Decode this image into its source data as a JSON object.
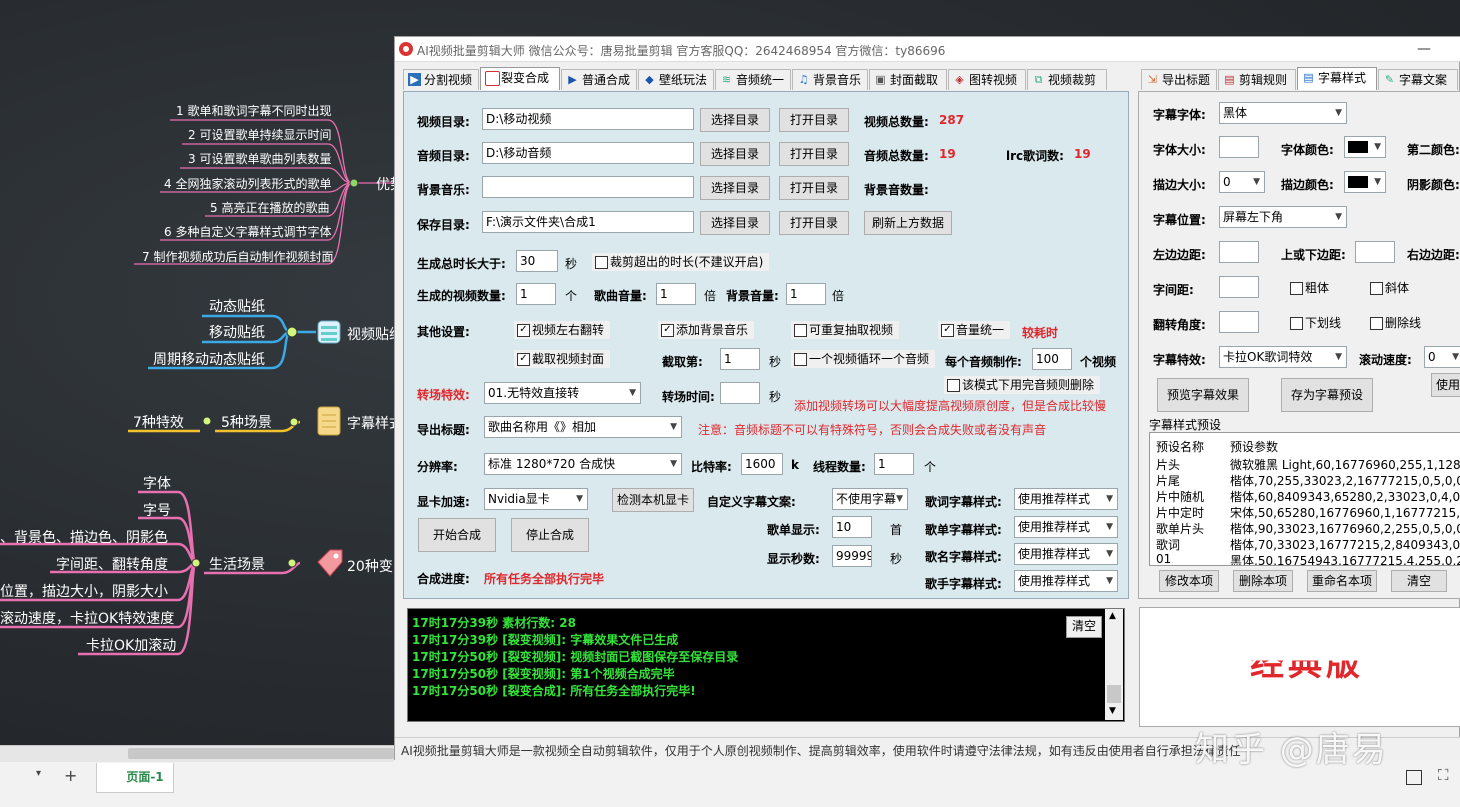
{
  "mindmap": {
    "branch1_items": [
      "1  歌单和歌词字幕不同时出现",
      "2  可设置歌单持续显示时间",
      "3  可设置歌单歌曲列表数量",
      "4  全网独家滚动列表形式的歌单",
      "5  高亮正在播放的歌曲",
      "6  多种自定义字幕样式调节字体",
      "7  制作视频成功后自动制作视频封面"
    ],
    "branch1_node": "优势",
    "branch2_items": [
      "动态贴纸",
      "移动贴纸",
      "周期移动动态贴纸"
    ],
    "branch2_node": "视频贴纸",
    "branch3_left": "7种特效",
    "branch3_mid": "5种场景",
    "branch3_node": "字幕样式",
    "branch4_items": [
      "字体",
      "字号",
      "、背景色、描边色、阴影色",
      "字间距、翻转角度",
      "位置，描边大小，阴影大小",
      "滚动速度，卡拉OK特效速度",
      "卡拉OK加滚动"
    ],
    "branch4_mid": "生活场景",
    "branch4_node": "20种变"
  },
  "sheetbar": {
    "tab": "页面-1",
    "add": "+"
  },
  "window": {
    "title": "AI视频批量剪辑大师  微信公众号：唐易批量剪辑  官方客服QQ：2642468954  官方微信：ty86696",
    "minimize": "—",
    "tabs": [
      "分割视频",
      "裂变合成",
      "普通合成",
      "壁纸玩法",
      "音频统一",
      "背景音乐",
      "封面截取",
      "图转视频",
      "视频裁剪"
    ],
    "right_tabs": [
      "导出标题",
      "剪辑规则",
      "字幕样式",
      "字幕文案"
    ],
    "status": "AI视频批量剪辑大师是一款视频全自动剪辑软件，仅用于个人原创视频制作、提高剪辑效率，使用软件时请遵守法律法规，如有违反由使用者自行承担法律责任"
  },
  "form": {
    "video_dir_label": "视频目录:",
    "video_dir": "D:\\移动视频",
    "audio_dir_label": "音频目录:",
    "audio_dir": "D:\\移动音频",
    "bgm_label": "背景音乐:",
    "bgm": "",
    "save_dir_label": "保存目录:",
    "save_dir": "F:\\演示文件夹\\合成1",
    "choose_dir": "选择目录",
    "open_dir": "打开目录",
    "refresh": "刷新上方数据",
    "video_total_label": "视频总数量:",
    "video_total": "287",
    "audio_total_label": "音频总数量:",
    "audio_total": "19",
    "lrc_label": "lrc歌词数:",
    "lrc_total": "19",
    "bgm_total_label": "背景音数量:",
    "duration_label": "生成总时长大于:",
    "duration": "30",
    "sec": "秒",
    "crop_over": "裁剪超出的时长(不建议开启)",
    "count_label": "生成的视频数量:",
    "count": "1",
    "unit_ge": "个",
    "song_vol_label": "歌曲音量:",
    "song_vol": "1",
    "unit_bei": "倍",
    "bg_vol_label": "背景音量:",
    "bg_vol": "1",
    "other_label": "其他设置:",
    "flip": "视频左右翻转",
    "add_bgm": "添加背景音乐",
    "repeat": "可重复抽取视频",
    "audio_unify": "音量统一",
    "slow": "较耗时",
    "capture_cover": "截取视频封面",
    "capture_at_label": "截取第:",
    "capture_at": "1",
    "loop_one": "一个视频循环一个音频",
    "per_audio_label": "每个音频制作:",
    "per_audio": "100",
    "per_audio_unit": "个视频",
    "mode_note": "该模式下用完音频则删除",
    "trans_label": "转场特效:",
    "trans": "01.无特效直接转",
    "trans_time_label": "转场时间:",
    "trans_time": "",
    "trans_hint": "添加视频转场可以大幅度提高视频原创度，但是合成比较慢",
    "export_title_label": "导出标题:",
    "export_title": "歌曲名称用《》相加",
    "export_note": "注意：音频标题不可以有特殊符号，否则会合成失败或者没有声音",
    "res_label": "分辨率:",
    "res": "标准 1280*720 合成快",
    "bitrate_label": "比特率:",
    "bitrate": "1600",
    "k": "k",
    "threads_label": "线程数量:",
    "threads": "1",
    "gpu_label": "显卡加速:",
    "gpu": "Nvidia显卡",
    "detect_gpu": "检测本机显卡",
    "custom_sub_label": "自定义字幕文案:",
    "custom_sub": "不使用字幕",
    "lyric_style_label": "歌词字幕样式:",
    "songlist_style_label": "歌单字幕样式:",
    "songname_style_label": "歌名字幕样式:",
    "singer_style_label": "歌手字幕样式:",
    "style_value": "使用推荐样式",
    "songlist_show_label": "歌单显示:",
    "songlist_show": "10",
    "shou": "首",
    "show_sec_label": "显示秒数:",
    "show_sec": "99999",
    "start": "开始合成",
    "stop": "停止合成",
    "progress_label": "合成进度:",
    "progress": "所有任务全部执行完毕"
  },
  "log": {
    "clear": "清空",
    "lines": [
      "17时17分39秒 素材行数: 28",
      "17时17分39秒 [裂变视频]: 字幕效果文件已生成",
      "17时17分50秒 [裂变视频]: 视频封面已截图保存至保存目录",
      "17时17分50秒 [裂变视频]: 第1个视频合成完毕",
      "17时17分50秒 [裂变合成]: 所有任务全部执行完毕!"
    ]
  },
  "subtitle": {
    "font_label": "字幕字体:",
    "font": "黑体",
    "size_label": "字体大小:",
    "size": "",
    "color_label": "字体颜色:",
    "second_color_label": "第二颜色:",
    "stroke_size_label": "描边大小:",
    "stroke_size": "0",
    "stroke_color_label": "描边颜色:",
    "shadow_color_label": "阴影颜色:",
    "pos_label": "字幕位置:",
    "pos": "屏幕左下角",
    "left_margin_label": "左边边距:",
    "vert_margin_label": "上或下边距:",
    "right_margin_label": "右边边距:",
    "spacing_label": "字间距:",
    "bold": "粗体",
    "italic": "斜体",
    "rotate_label": "翻转角度:",
    "underline": "下划线",
    "strike": "删除线",
    "effect_label": "字幕特效:",
    "effect": "卡拉OK歌词特效",
    "scroll_label": "滚动速度:",
    "scroll": "0",
    "preview_btn": "预览字幕效果",
    "save_preset": "存为字幕预设",
    "use": "使用",
    "preset_group": "字幕样式预设",
    "preset_head": [
      "预设名称",
      "预设参数"
    ],
    "presets": [
      [
        "片头",
        "微软雅黑 Light,60,16776960,255,1,128,1"
      ],
      [
        "片尾",
        "楷体,70,255,33023,2,16777215,0,5,0,0,5,"
      ],
      [
        "片中随机",
        "楷体,60,8409343,65280,2,33023,0,4,0,0,"
      ],
      [
        "片中定时",
        "宋体,50,65280,16776960,1,16777215,0,6,"
      ],
      [
        "歌单片头",
        "楷体,90,33023,16776960,2,255,0,5,0,0,8"
      ],
      [
        "歌词",
        "楷体,70,33023,16777215,2,8409343,0,2,0,"
      ],
      [
        "01",
        "黑体,50,16754943,16777215,4,255,0,2,0,"
      ]
    ],
    "edit": "修改本项",
    "delete": "删除本项",
    "rename": "重命名本项",
    "clear": "清空",
    "preview_text": "经典版"
  },
  "watermark": "知乎 @唐易",
  "colors": {
    "panel": "#d9e9ee",
    "accent_red": "#e0282c",
    "log_green": "#35e23b",
    "pink": "#e86fb0",
    "blue": "#3aa9e6",
    "yellow": "#f2c12e"
  }
}
